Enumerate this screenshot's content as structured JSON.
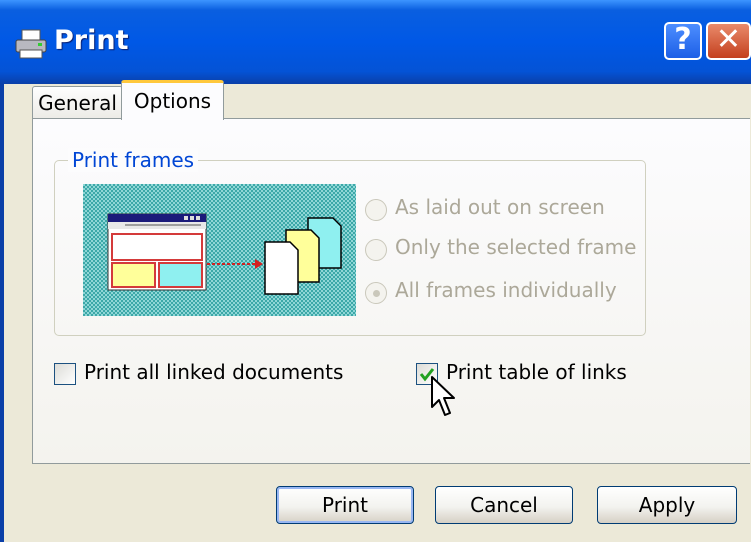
{
  "window": {
    "title": "Print",
    "help_glyph": "?",
    "close_glyph": "✕",
    "icon": "printer-icon"
  },
  "tabs": [
    {
      "label": "General",
      "selected": false
    },
    {
      "label": "Options",
      "selected": true
    }
  ],
  "print_frames": {
    "legend": "Print frames",
    "options": [
      {
        "label": "As laid out on screen",
        "selected": false,
        "enabled": false
      },
      {
        "label": "Only the selected frame",
        "selected": false,
        "enabled": false
      },
      {
        "label": "All frames individually",
        "selected": true,
        "enabled": false
      }
    ]
  },
  "checkboxes": {
    "print_linked_documents": {
      "label": "Print all linked documents",
      "checked": false
    },
    "print_table_of_links": {
      "label": "Print table of links",
      "checked": true
    }
  },
  "buttons": {
    "print": "Print",
    "cancel": "Cancel",
    "apply": "Apply"
  },
  "colors": {
    "titlebar": "#0058e6",
    "group_legend": "#0046d5",
    "tab_highlight": "#ffc83c",
    "disabled_text": "#aca899",
    "check_mark": "#21a121"
  }
}
